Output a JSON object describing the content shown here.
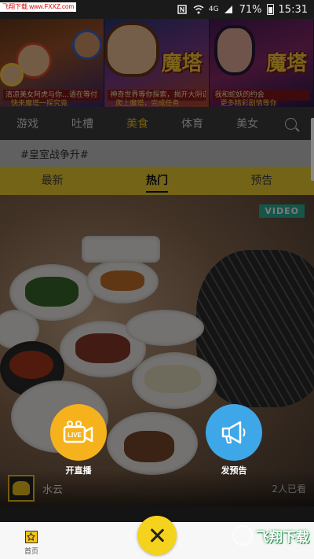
{
  "status_bar": {
    "watermark": "飞翔下载 www.FXXZ.com",
    "network": "4G",
    "battery": "71%",
    "time": "15:31"
  },
  "banner": {
    "ads": [
      {
        "title": "",
        "caption": "清凉美女阿虎与你…语在等付",
        "caption2": "快来魔塔一探究竟"
      },
      {
        "title": "魔塔",
        "caption": "神奇世界等你探索，揭开大阴谋",
        "caption2": "爬上魔塔，完成任务"
      },
      {
        "title": "魔塔",
        "caption": "我和蛇妖的约会",
        "caption2": "更多精彩剧情等你"
      }
    ]
  },
  "categories": [
    "游戏",
    "吐槽",
    "美食",
    "体育",
    "美女"
  ],
  "active_category": "美食",
  "topic": "#皇室战争升#",
  "sub_tabs": [
    "最新",
    "热门",
    "预告"
  ],
  "active_sub_tab": "热门",
  "card": {
    "badge": "VIDEO",
    "author": "水云",
    "viewers": "2人已看"
  },
  "actions": {
    "live_label": "开直播",
    "live_icon_text": "LIVE",
    "preview_label": "发预告"
  },
  "bottom_nav": {
    "home_label": "首页"
  },
  "watermark_bottom": "飞翔下载",
  "colors": {
    "accent_yellow": "#f5c518",
    "live_orange": "#f5b21c",
    "preview_blue": "#3ea7e8",
    "video_badge": "#2bb59a"
  }
}
